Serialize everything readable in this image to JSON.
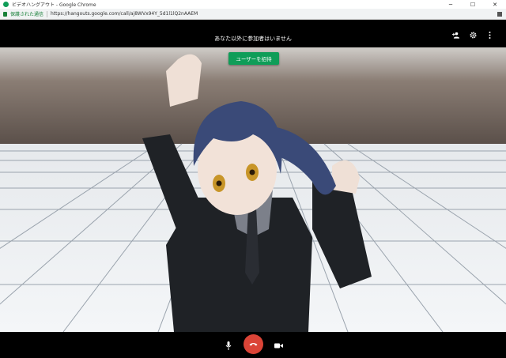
{
  "window": {
    "title": "ビデオハングアウト - Google Chrome",
    "controls": {
      "minimize": "─",
      "maximize": "☐",
      "close": "✕"
    }
  },
  "addressbar": {
    "security_label": "保護された通信",
    "url": "https://hangouts.google.com/call/aj8WVx94Y_5d1l1lQ2nAAEM"
  },
  "call": {
    "status_text": "あなた以外に参加者はいません",
    "invite_button": "ユーザーを招待",
    "header_icons": [
      "add-person-icon",
      "settings-icon",
      "more-vert-icon"
    ],
    "control_icons": [
      "microphone-icon",
      "hangup-icon",
      "camera-icon"
    ]
  },
  "colors": {
    "invite_green": "#0f9d58",
    "hangup_red": "#db4437",
    "secure_green": "#188038"
  }
}
